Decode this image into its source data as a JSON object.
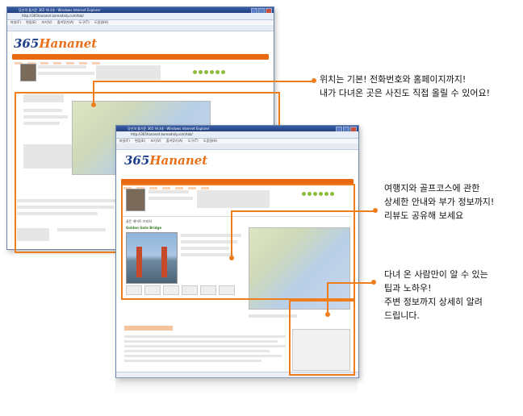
{
  "window1": {
    "title": "당신의 즐거운 365 하나대 - Windows Internet Explorer",
    "address": "http://365hananet.koreadaily.com/tab/",
    "menu": [
      "파일(F)",
      "편집(E)",
      "보기(V)",
      "즐겨찾기(A)",
      "도구(T)",
      "도움말(H)"
    ],
    "logo_365": "365",
    "logo_name": "Hananet"
  },
  "window2": {
    "title": "당신의 즐거운 365 하나대 - Windows Internet Explorer",
    "address": "http://365hananet.koreadaily.com/tab/",
    "menu": [
      "파일(F)",
      "편집(E)",
      "보기(V)",
      "즐겨찾기(A)",
      "도구(T)",
      "도움말(H)"
    ],
    "logo_365": "365",
    "logo_name": "Hananet",
    "place_title": "Golden Gate Bridge",
    "place_heading": "골든 게이트 브리지"
  },
  "callouts": {
    "contact": [
      "위치는 기본! 전화번호와 홈페이지까지!",
      "내가 다녀온 곳은 사진도 직접 올릴 수 있어요!"
    ],
    "travel": [
      "여행지와 골프코스에 관한",
      "상세한 안내와 부가 정보까지!",
      "리뷰도 공유해 보세요"
    ],
    "tips": [
      "다녀 온 사람만이 알 수 있는",
      "팁과 노하우!",
      "주변 정보까지 상세히 알려",
      "드립니다."
    ]
  },
  "colors": {
    "accent": "#f07d1c",
    "nav": "#e86a10",
    "titlebar": "#203f7e"
  }
}
